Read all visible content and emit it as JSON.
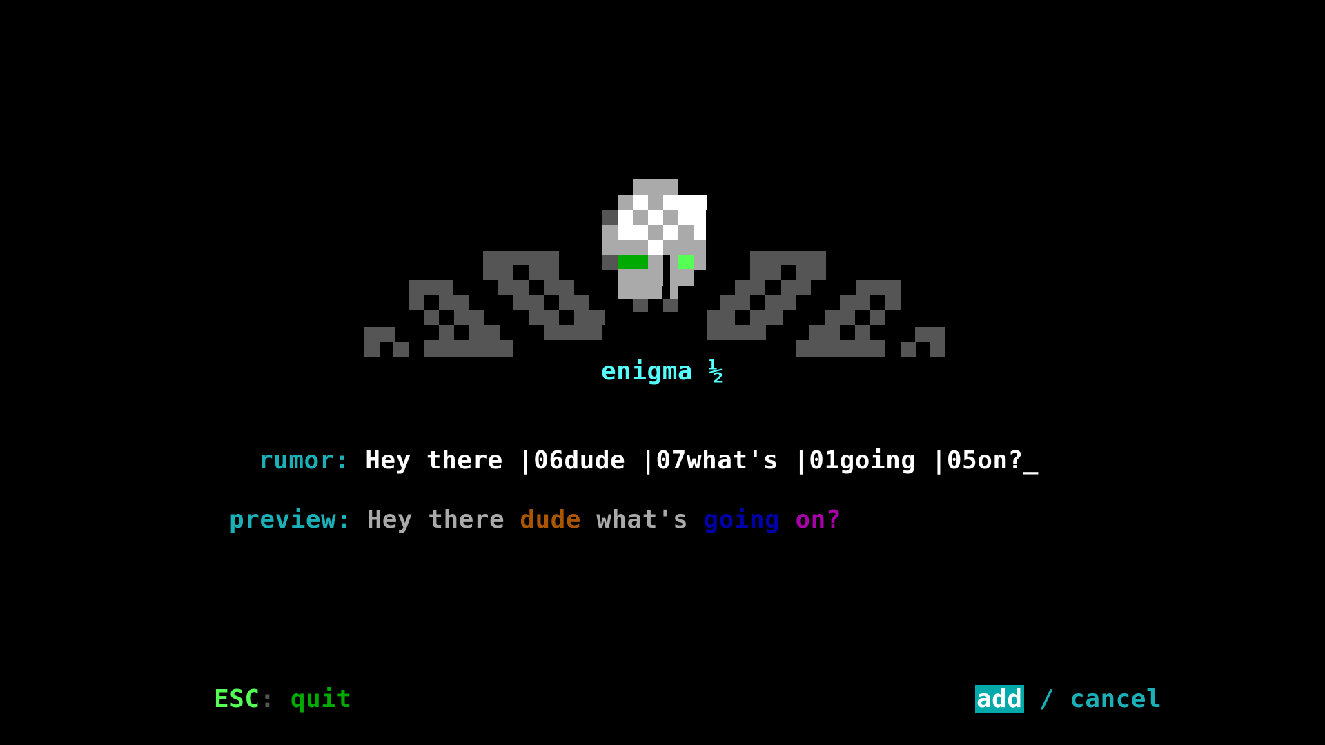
{
  "banner": {
    "title": "enigma ½"
  },
  "rumor": {
    "label": "rumor:",
    "value": "Hey there |06dude |07what's |01going |05on?",
    "cursor": "_"
  },
  "preview": {
    "label": "preview:",
    "segments": [
      {
        "text": "Hey there ",
        "color": "#aaaaaa"
      },
      {
        "text": "dude ",
        "color": "#aa5500"
      },
      {
        "text": "what's ",
        "color": "#aaaaaa"
      },
      {
        "text": "going ",
        "color": "#0000aa"
      },
      {
        "text": "on?",
        "color": "#aa00aa"
      }
    ]
  },
  "footer": {
    "esc_key": "ESC",
    "esc_sep": ":",
    "esc_action": "quit",
    "add_label": "add",
    "separator": "/",
    "cancel_label": "cancel"
  },
  "colors": {
    "background": "#000000",
    "art_dark": "#555555",
    "art_light": "#aaaaaa",
    "art_white": "#ffffff",
    "eye_left": "#00aa00",
    "eye_right": "#55ff55",
    "title": "#55ffff",
    "label": "#1bb0b8",
    "accent": "#00aaaa"
  }
}
